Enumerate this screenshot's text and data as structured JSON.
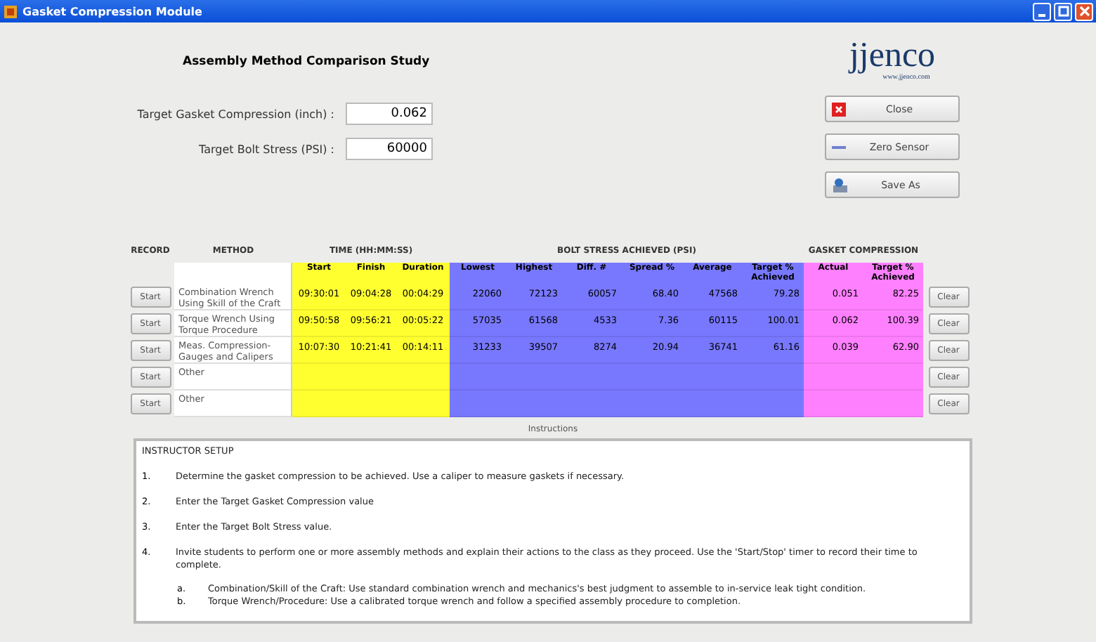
{
  "window": {
    "title": "Gasket Compression Module"
  },
  "heading": "Assembly Method Comparison Study",
  "fields": [
    {
      "label": "Target Gasket Compression (inch) :",
      "value": "0.062"
    },
    {
      "label": "Target Bolt Stress (PSI) :",
      "value": "60000"
    }
  ],
  "logo": {
    "name": "jjenco",
    "url": "www.jjenco.com"
  },
  "buttons": [
    {
      "label": "Close",
      "kind": "close"
    },
    {
      "label": "Zero Sensor",
      "kind": "zero"
    },
    {
      "label": "Save As",
      "kind": "save"
    }
  ],
  "table": {
    "groups": [
      {
        "label": "RECORD",
        "kind": "record"
      },
      {
        "label": "METHOD",
        "kind": "method"
      },
      {
        "label": "TIME (HH:MM:SS)",
        "kind": "time"
      },
      {
        "label": "BOLT STRESS ACHIEVED (PSI)",
        "kind": "stress"
      },
      {
        "label": "GASKET COMPRESSION",
        "kind": "gasket"
      }
    ],
    "columns": [
      {
        "label": "Start",
        "kind": "time"
      },
      {
        "label": "Finish",
        "kind": "time"
      },
      {
        "label": "Duration",
        "kind": "time"
      },
      {
        "label": "Lowest",
        "kind": "stress"
      },
      {
        "label": "Highest",
        "kind": "stress"
      },
      {
        "label": "Diff. #",
        "kind": "stress"
      },
      {
        "label": "Spread %",
        "kind": "stress"
      },
      {
        "label": "Average",
        "kind": "stress"
      },
      {
        "label": "Target % Achieved",
        "kind": "stress"
      },
      {
        "label": "Actual",
        "kind": "gasket"
      },
      {
        "label": "Target % Achieved",
        "kind": "gasket"
      }
    ],
    "rows": [
      {
        "record": "Start",
        "method": "Combination Wrench Using Skill of the Craft",
        "values": [
          "09:30:01",
          "09:04:28",
          "00:04:29",
          "22060",
          "72123",
          "60057",
          "68.40",
          "47568",
          "79.28",
          "0.051",
          "82.25"
        ],
        "clear": "Clear"
      },
      {
        "record": "Start",
        "method": "Torque Wrench Using Torque Procedure",
        "values": [
          "09:50:58",
          "09:56:21",
          "00:05:22",
          "57035",
          "61568",
          "4533",
          "7.36",
          "60115",
          "100.01",
          "0.062",
          "100.39"
        ],
        "clear": "Clear"
      },
      {
        "record": "Start",
        "method": "Meas. Compression-Gauges and Calipers",
        "values": [
          "10:07:30",
          "10:21:41",
          "00:14:11",
          "31233",
          "39507",
          "8274",
          "20.94",
          "36741",
          "61.16",
          "0.039",
          "62.90"
        ],
        "clear": "Clear"
      },
      {
        "record": "Start",
        "method": "Other",
        "clear": "Clear"
      },
      {
        "record": "Start",
        "method": "Other",
        "clear": "Clear"
      }
    ]
  },
  "instructions": {
    "label": "Instructions",
    "title": "INSTRUCTOR SETUP",
    "steps": [
      {
        "number": "1.",
        "text": "Determine the gasket compression to be achieved. Use a caliper to measure gaskets if necessary."
      },
      {
        "number": "2.",
        "text": "Enter the Target Gasket Compression value"
      },
      {
        "number": "3.",
        "text": "Enter the Target Bolt Stress value."
      },
      {
        "number": "4.",
        "text": "Invite students to perform one or more assembly methods and explain their actions to the class as they proceed. Use the 'Start/Stop' timer to record their time to complete."
      }
    ],
    "substeps": [
      {
        "number": "a.",
        "text": "Combination/Skill of the Craft: Use standard combination wrench and mechanics's best judgment to assemble to in-service leak tight condition."
      },
      {
        "number": "b.",
        "text": "Torque Wrench/Procedure: Use a calibrated torque wrench and follow a specified assembly procedure to completion."
      }
    ]
  }
}
